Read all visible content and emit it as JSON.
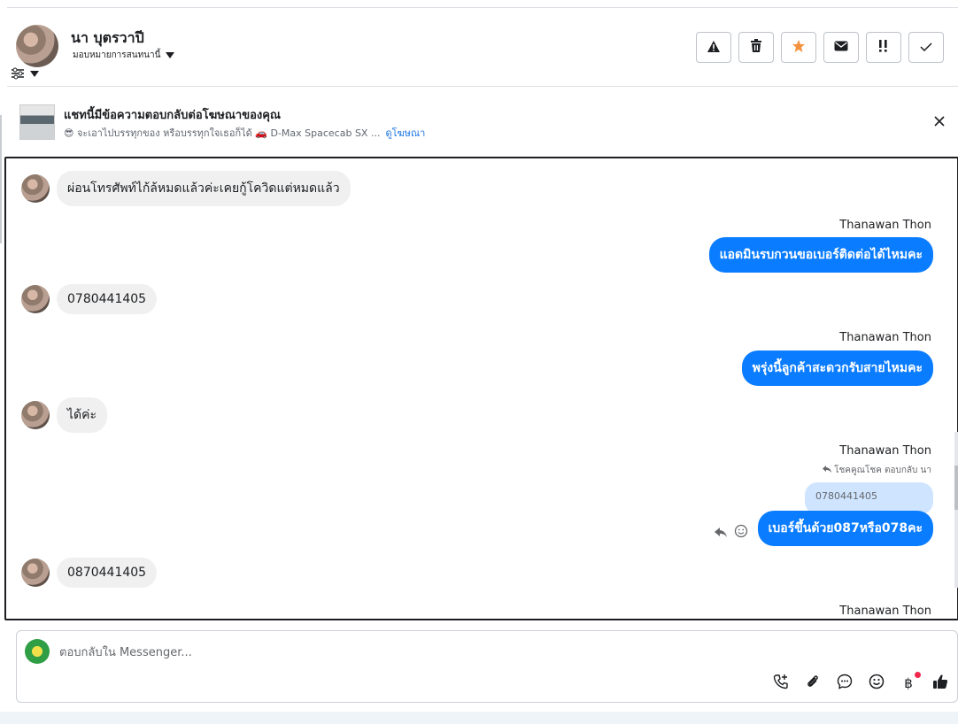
{
  "header": {
    "contact_name": "นา บุตรวาปี",
    "assign_label": "มอบหมายการสนทนานี้"
  },
  "actions": [
    {
      "name": "spam-button",
      "icon": "warning-icon"
    },
    {
      "name": "delete-button",
      "icon": "trash-icon"
    },
    {
      "name": "star-button",
      "icon": "star-icon",
      "color": "#f5923e"
    },
    {
      "name": "mark-unread-button",
      "icon": "envelope-icon"
    },
    {
      "name": "follow-up-button",
      "icon": "exclamation-icon"
    },
    {
      "name": "done-button",
      "icon": "check-icon"
    }
  ],
  "ad": {
    "title": "แชทนี้มีข้อความตอบกลับต่อโฆษณาของคุณ",
    "snippet": "😎 จะเอาไปบรรทุกของ หรือบรรทุกใจเธอก็ได้ 🚗 D-Max Spacecab SX ...",
    "link": "ดูโฆษณา"
  },
  "messages": {
    "m1": "ผ่อนโทรศัพท์ไก้ล้หมดแล้วค่ะเคยกู้โควิดแต่หมดแล้ว",
    "sender": "Thanawan Thon",
    "m2": "แอดมินรบกวนขอเบอร์ติดต่อได้ไหมคะ",
    "m3": "0780441405",
    "m4": "พรุ่งนี้ลูกค้าสะดวกรับสายไหมคะ",
    "m5": "ได้ค่ะ",
    "replied_note": "โชคคูณโชค ตอบกลับ นา",
    "quoted": "0780441405",
    "m6": "เบอร์ขึ้นด้วย087หรือ078คะ",
    "m7": "0870441405"
  },
  "composer": {
    "placeholder": "ตอบกลับใน Messenger..."
  },
  "colors": {
    "accent": "#0a7cff",
    "incoming_bubble": "#f0f0f0",
    "quoted_bubble": "#cfe5ff",
    "notification_dot": "#f02849"
  }
}
